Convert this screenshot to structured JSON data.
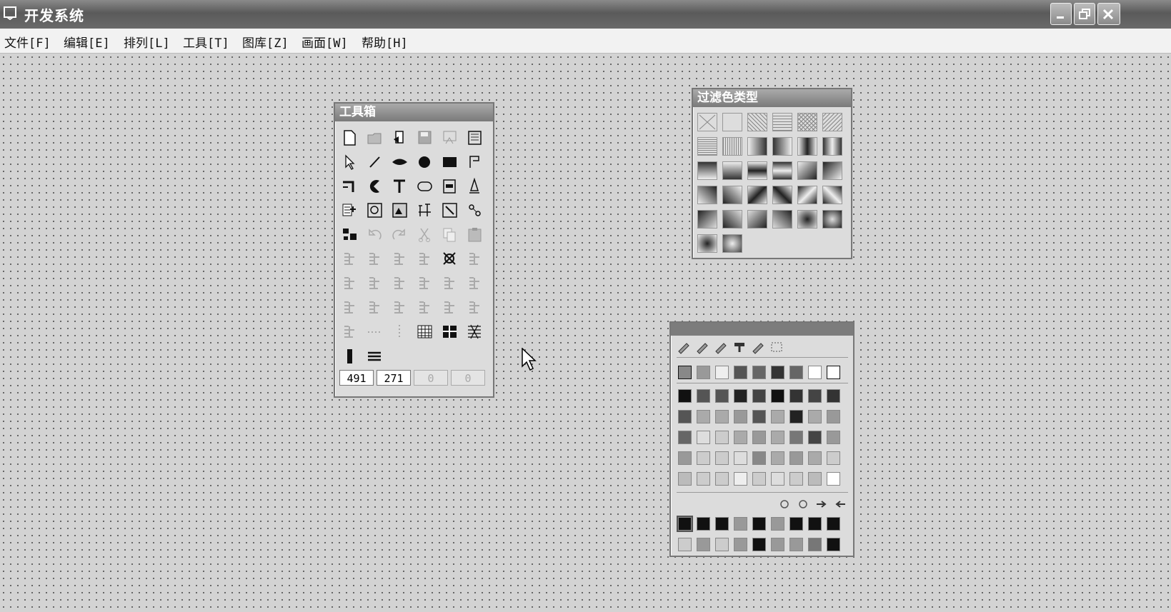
{
  "window": {
    "title": "开发系统"
  },
  "menu": [
    "文件[F]",
    "编辑[E]",
    "排列[L]",
    "工具[T]",
    "图库[Z]",
    "画面[W]",
    "帮助[H]"
  ],
  "toolbox": {
    "title": "工具箱",
    "tools": [
      "new-file-icon",
      "open-folder-icon",
      "import-icon",
      "save-icon",
      "preview-icon",
      "document-icon",
      "pointer-icon",
      "line-icon",
      "lens-icon",
      "ellipse-icon",
      "rectangle-icon",
      "polyline-icon",
      "corner-line-icon",
      "pie-icon",
      "text-icon",
      "rounded-rect-icon",
      "button-icon",
      "lamp-icon",
      "meter-icon",
      "picture-icon",
      "image-icon",
      "symbol-icon",
      "resize-icon",
      "link-icon",
      "group-icon",
      "undo-icon",
      "redo-icon",
      "cut-icon",
      "copy-icon",
      "paste-icon",
      "align-icon",
      "align-center-icon",
      "align-v-icon",
      "distribute-icon",
      "ungroup-icon",
      "arrow-icon",
      "move-front-icon",
      "move-back-icon",
      "flip-icon",
      "rotate-left-icon",
      "rotate-right-icon",
      "columns-icon",
      "align-top-icon",
      "align-bottom-icon",
      "center-h-icon",
      "equal-width-icon",
      "equal-height-icon",
      "space-icon",
      "tab-order-icon",
      "dots-h-icon",
      "dots-v-icon",
      "grid-fine-icon",
      "grid-coarse-icon",
      "grid-style-icon",
      "bar-icon",
      "lines-icon"
    ],
    "coords": [
      "491",
      "271",
      "0",
      "0"
    ]
  },
  "filter_panel": {
    "title": "过滤色类型"
  },
  "color_panel": {
    "tools": [
      "pen-icon",
      "fill-icon",
      "brush-icon",
      "text-color-icon",
      "palette-icon",
      "grid-icon"
    ],
    "row_tools": [
      "refresh-icon",
      "target-icon",
      "right-arrow-icon",
      "left-arrow-icon"
    ],
    "top_swatches": [
      "#888",
      "#999",
      "#eee",
      "#555",
      "#666",
      "#333",
      "#666",
      "#fff",
      "#fff"
    ],
    "grid": [
      [
        "#111",
        "#555",
        "#555",
        "#222",
        "#444",
        "#111",
        "#333",
        "#444",
        "#333"
      ],
      [
        "#555",
        "#aaa",
        "#aaa",
        "#999",
        "#555",
        "#aaa",
        "#222",
        "#aaa",
        "#999"
      ],
      [
        "#666",
        "#ddd",
        "#ccc",
        "#aaa",
        "#999",
        "#aaa",
        "#777",
        "#444",
        "#999"
      ],
      [
        "#999",
        "#ccc",
        "#ccc",
        "#ddd",
        "#888",
        "#aaa",
        "#999",
        "#aaa",
        "#ccc"
      ],
      [
        "#bbb",
        "#ccc",
        "#ccc",
        "#eee",
        "#ccc",
        "#ddd",
        "#ccc",
        "#bbb",
        "#fff"
      ]
    ],
    "custom": [
      [
        "#111",
        "#111",
        "#111",
        "#999",
        "#111",
        "#999",
        "#111",
        "#111",
        "#111"
      ],
      [
        "#ccc",
        "#999",
        "#ccc",
        "#999",
        "#111",
        "#999",
        "#999",
        "#777",
        "#111"
      ]
    ]
  }
}
